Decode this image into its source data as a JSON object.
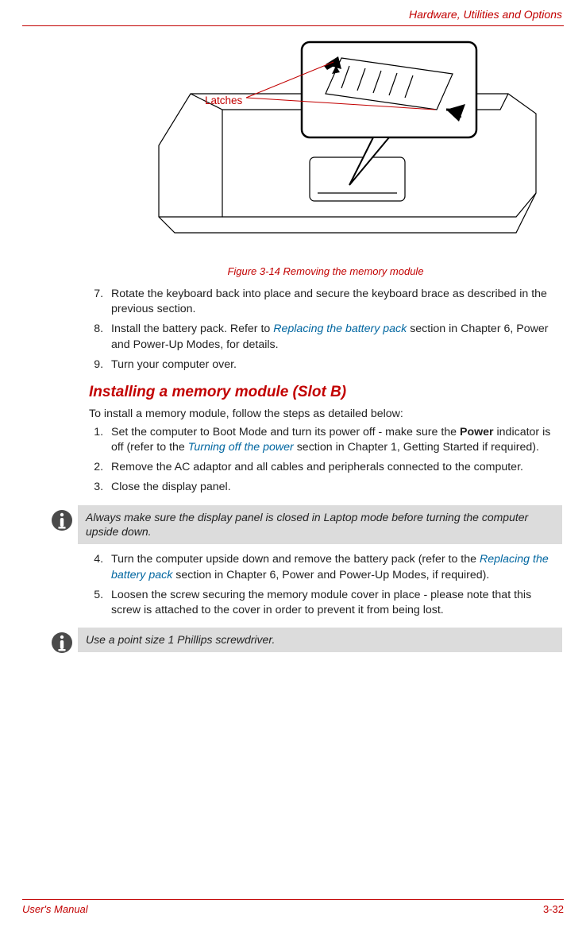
{
  "header": {
    "section": "Hardware, Utilities and Options"
  },
  "figure": {
    "label_latches": "Latches",
    "caption": "Figure 3-14 Removing the memory module"
  },
  "steps_a": {
    "start": 7,
    "items": [
      {
        "pre": "Rotate the keyboard back into place and secure the keyboard brace as described in the previous section."
      },
      {
        "pre": "Install the battery pack. Refer to ",
        "link": "Replacing the battery pack",
        "post": " section in Chapter 6, Power and Power-Up Modes, for details."
      },
      {
        "pre": "Turn your computer over."
      }
    ]
  },
  "section_b": {
    "heading": "Installing a memory module (Slot B)",
    "intro": "To install a memory module, follow the steps as detailed below:"
  },
  "steps_b1": {
    "start": 1,
    "items": [
      {
        "pre": "Set the computer to Boot Mode and turn its power off - make sure the ",
        "bold": "Power",
        "mid": " indicator is off (refer to the ",
        "link": "Turning off the power",
        "post": " section in Chapter 1, Getting Started if required)."
      },
      {
        "pre": "Remove the AC adaptor and all cables and peripherals connected to the computer."
      },
      {
        "pre": "Close the display panel."
      }
    ]
  },
  "note1": {
    "text": "Always make sure the display panel is closed in Laptop mode before turning the computer upside down."
  },
  "steps_b2": {
    "start": 4,
    "items": [
      {
        "pre": "Turn the computer upside down and remove the battery pack (refer to the ",
        "link": "Replacing the battery pack",
        "post": " section in Chapter 6, Power and Power-Up Modes, if required)."
      },
      {
        "pre": "Loosen the screw securing the memory module cover in place - please note that this screw is attached to the cover in order to prevent it from being lost."
      }
    ]
  },
  "note2": {
    "text": "Use a point size 1 Phillips screwdriver."
  },
  "footer": {
    "left": "User's Manual",
    "right": "3-32"
  }
}
